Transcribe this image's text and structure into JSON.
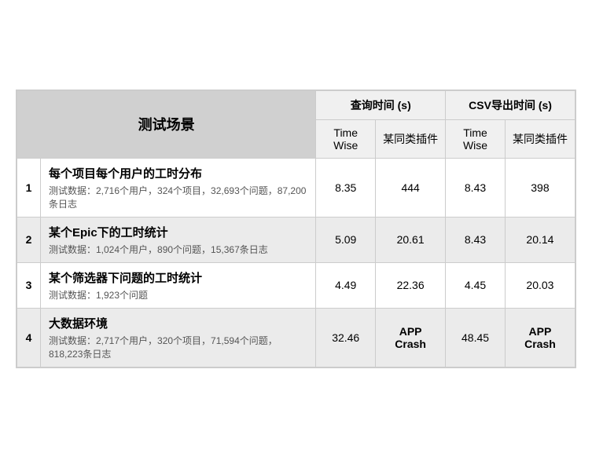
{
  "table": {
    "headers": {
      "scenario": "测试场景",
      "query_time": "查询时间 (s)",
      "csv_time": "CSV导出时间 (s)",
      "col_timewise_1": "Time Wise",
      "col_plugin_1": "某同类插件",
      "col_timewise_2": "Time Wise",
      "col_plugin_2": "某同类插件"
    },
    "rows": [
      {
        "num": "1",
        "title": "每个项目每个用户的工时分布",
        "desc": "测试数据：2,716个用户，324个项目，32,693个问题，87,200条日志",
        "query_timewise": "8.35",
        "query_plugin": "444",
        "csv_timewise": "8.43",
        "csv_plugin": "398"
      },
      {
        "num": "2",
        "title": "某个Epic下的工时统计",
        "desc": "测试数据：1,024个用户，890个问题，15,367条日志",
        "query_timewise": "5.09",
        "query_plugin": "20.61",
        "csv_timewise": "8.43",
        "csv_plugin": "20.14"
      },
      {
        "num": "3",
        "title": "某个筛选器下问题的工时统计",
        "desc": "测试数据：1,923个问题",
        "query_timewise": "4.49",
        "query_plugin": "22.36",
        "csv_timewise": "4.45",
        "csv_plugin": "20.03"
      },
      {
        "num": "4",
        "title": "大数据环境",
        "desc": "测试数据：2,717个用户，320个项目，71,594个问题，818,223条日志",
        "query_timewise": "32.46",
        "query_plugin": "APP Crash",
        "csv_timewise": "48.45",
        "csv_plugin": "APP Crash"
      }
    ]
  }
}
